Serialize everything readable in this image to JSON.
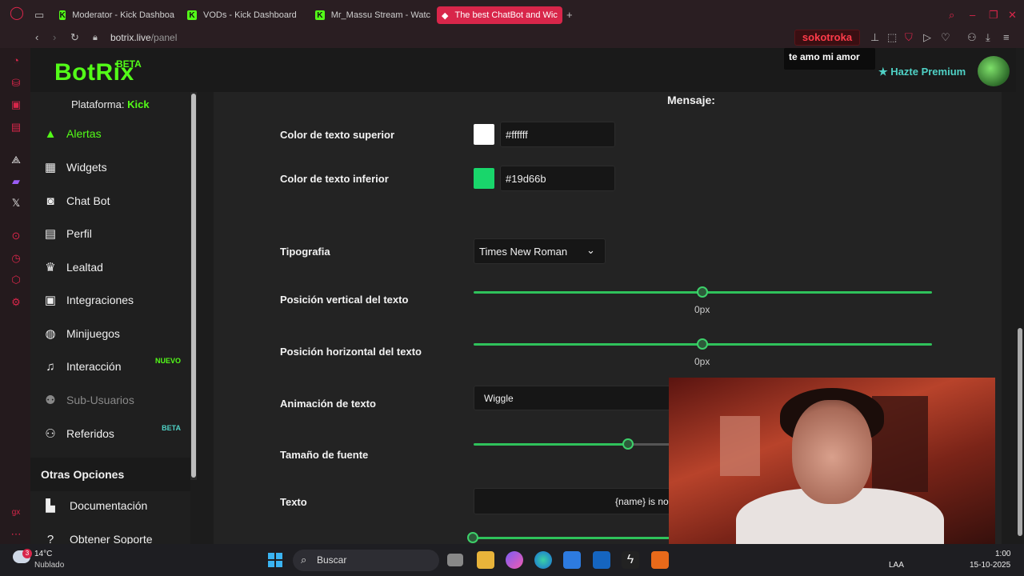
{
  "browser": {
    "tabs": [
      {
        "title": "Moderator - Kick Dashboa",
        "active": false
      },
      {
        "title": "VODs - Kick Dashboard",
        "active": false
      },
      {
        "title": "Mr_Massu Stream - Watc",
        "active": false
      },
      {
        "title": "The best ChatBot and Wic",
        "active": true
      }
    ],
    "url_host": "botrix.live",
    "url_path": "/panel"
  },
  "header": {
    "logo": "BotRix",
    "logo_beta": "BETA",
    "premium": "Hazte Premium"
  },
  "sidebar": {
    "platform_label": "Plataforma:",
    "platform_value": "Kick",
    "items": [
      {
        "label": "Alertas",
        "icon": "warning-icon",
        "active": true
      },
      {
        "label": "Widgets",
        "icon": "grid-icon"
      },
      {
        "label": "Chat Bot",
        "icon": "robot-icon"
      },
      {
        "label": "Perfil",
        "icon": "id-card-icon"
      },
      {
        "label": "Lealtad",
        "icon": "trophy-icon"
      },
      {
        "label": "Integraciones",
        "icon": "chat-icon"
      },
      {
        "label": "Minijuegos",
        "icon": "gamepad-icon"
      },
      {
        "label": "Interacción",
        "icon": "music-icon",
        "badge": "NUEVO"
      },
      {
        "label": "Sub-Usuarios",
        "icon": "users-icon",
        "disabled": true
      },
      {
        "label": "Referidos",
        "icon": "user-group-icon",
        "badge": "BETA"
      }
    ],
    "other_options": "Otras Opciones",
    "other_items": [
      {
        "label": "Documentación",
        "icon": "book-icon"
      },
      {
        "label": "Obtener Soporte",
        "icon": "help-icon"
      }
    ]
  },
  "form": {
    "section_title": "Mensaje:",
    "top_color_label": "Color de texto superior",
    "top_color_value": "#ffffff",
    "bottom_color_label": "Color de texto inferior",
    "bottom_color_value": "#19d66b",
    "font_label": "Tipografia",
    "font_value": "Times New Roman",
    "vpos_label": "Posición vertical del texto",
    "vpos_value": "0px",
    "hpos_label": "Posición horizontal del texto",
    "hpos_value": "0px",
    "anim_label": "Animación de texto",
    "anim_value": "Wiggle",
    "size_label": "Tamaño de fuente",
    "text_label": "Texto",
    "text_value": "{name} is no"
  },
  "overlay": {
    "chat_user": "sokotroka",
    "chat_message": "te amo mi amor"
  },
  "taskbar": {
    "weather_badge": "3",
    "temp": "14°C",
    "weather": "Nublado",
    "search_placeholder": "Buscar",
    "lang": "LAA",
    "time": "1:00",
    "date": "15-10-2025"
  },
  "colors": {
    "accent": "#53fc18",
    "slider": "#2fc25b",
    "opera_red": "#d8264a"
  }
}
